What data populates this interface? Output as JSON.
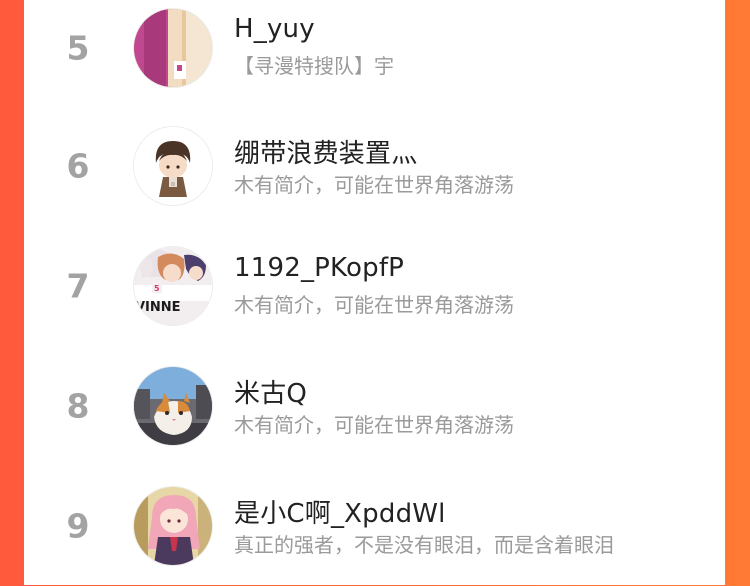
{
  "users": [
    {
      "rank": "5",
      "name": "H_yuy",
      "bio": "【寻漫特搜队】宇",
      "avatar": "avatar-room-door"
    },
    {
      "rank": "6",
      "name": "绷带浪费装置灬",
      "bio": "木有简介，可能在世界角落游荡",
      "avatar": "avatar-chibi-boy"
    },
    {
      "rank": "7",
      "name": "1192_PKopfP",
      "bio": "木有简介，可能在世界角落游荡",
      "avatar": "avatar-anime-winners"
    },
    {
      "rank": "8",
      "name": "米古Q",
      "bio": "木有简介，可能在世界角落游荡",
      "avatar": "avatar-cat-street"
    },
    {
      "rank": "9",
      "name": "是小C啊_XpddWl",
      "bio": "真正的强者，不是没有眼泪，而是含着眼泪",
      "avatar": "avatar-anime-girl"
    }
  ],
  "colors": {
    "background_gradient_start": "#ff5a3c",
    "background_gradient_end": "#ff7a34",
    "rank_color": "#a3a3a3",
    "name_color": "#222222",
    "bio_color": "#9a9a9a"
  }
}
